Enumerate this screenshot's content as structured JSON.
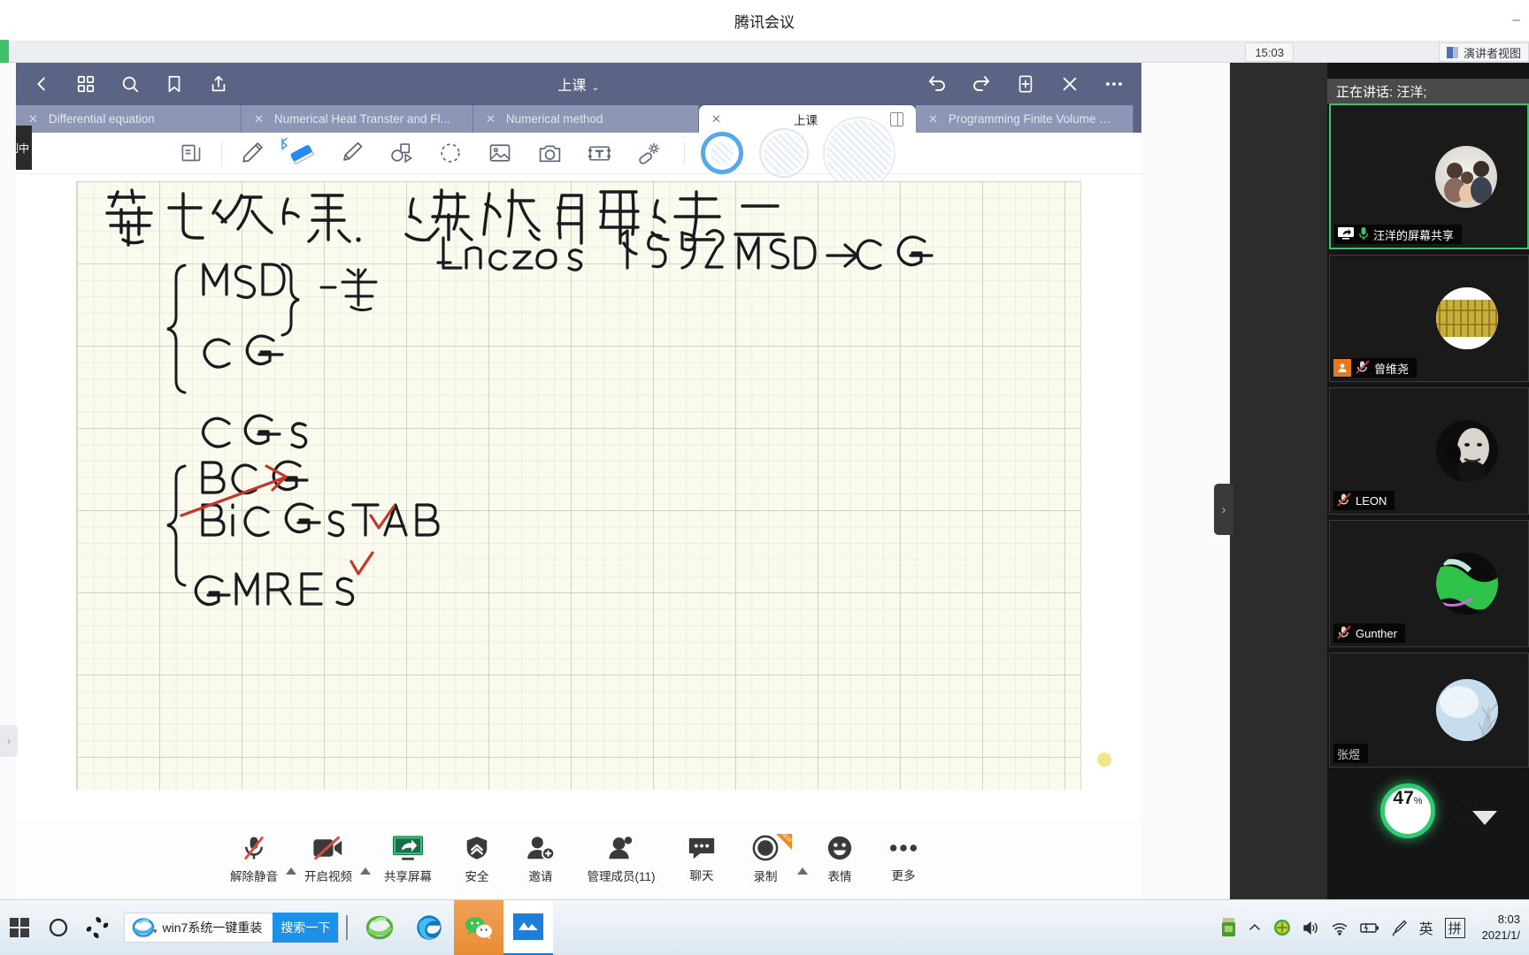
{
  "meeting": {
    "title": "腾讯会议",
    "minimize_label": "–",
    "clock": "15:03",
    "speaker_view_label": "演讲者视图",
    "recording_tag": "制中"
  },
  "note_app": {
    "doc_title": "上课",
    "doc_title_caret": "⌄",
    "top_icons_left": [
      "back-icon",
      "grid-icon",
      "search-icon",
      "bookmark-icon",
      "share-icon"
    ],
    "top_icons_right": [
      "undo-icon",
      "redo-icon",
      "add-page-icon",
      "close-icon",
      "more-icon"
    ],
    "tabs": [
      {
        "label": "Differential equation",
        "close": "✕",
        "active": false
      },
      {
        "label": "Numerical Heat Transter and Fl...",
        "close": "✕",
        "active": false
      },
      {
        "label": "Numerical method",
        "close": "✕",
        "active": false
      },
      {
        "label": "上课",
        "close": "✕",
        "active": true
      },
      {
        "label": "Programming Finite Volume Met...",
        "close": "✕",
        "active": false
      }
    ],
    "tools": [
      {
        "name": "page-layout-icon",
        "selected": false
      },
      {
        "name": "pen-icon",
        "selected": false
      },
      {
        "name": "eraser-icon",
        "selected": true
      },
      {
        "name": "highlighter-icon",
        "selected": false
      },
      {
        "name": "shapes-icon",
        "selected": false
      },
      {
        "name": "lasso-select-icon",
        "selected": false
      },
      {
        "name": "image-icon",
        "selected": false
      },
      {
        "name": "camera-icon",
        "selected": false
      },
      {
        "name": "text-box-icon",
        "selected": false
      },
      {
        "name": "magic-wand-icon",
        "selected": false
      }
    ],
    "brush_sizes": [
      {
        "name": "brush-size-small",
        "selected": true
      },
      {
        "name": "brush-size-medium",
        "selected": false
      },
      {
        "name": "brush-size-large",
        "selected": false
      }
    ]
  },
  "handwriting": {
    "title": "第七次课. 迭代解法二",
    "group1": [
      "MSD",
      "CG",
      "CGS"
    ],
    "group1_brace_note": "一类",
    "group2": [
      "BCG",
      "BiCGSTAB",
      "GMRES"
    ],
    "note_line": "Lanczos   1952   MSD → CG",
    "checks": [
      "✓",
      "✓"
    ],
    "bcg_struck_out": true
  },
  "video_sidebar": {
    "speaking_now": "正在讲话: 汪洋;",
    "participants": [
      {
        "name": "汪洋的屏幕共享",
        "muted": false,
        "host": false,
        "speaking": true,
        "avatar": "family-photo-avatar",
        "has_share_icon": true
      },
      {
        "name": "曾维尧",
        "muted": true,
        "host": true,
        "speaking": false,
        "avatar": "gold-texture-avatar",
        "has_share_icon": false
      },
      {
        "name": "LEON",
        "muted": true,
        "host": false,
        "speaking": false,
        "avatar": "portrait-avatar",
        "has_share_icon": false
      },
      {
        "name": "Gunther",
        "muted": true,
        "host": false,
        "speaking": false,
        "avatar": "green-lizard-avatar",
        "has_share_icon": false
      },
      {
        "name": "张煜",
        "muted": false,
        "host": false,
        "speaking": false,
        "avatar": "sky-tree-avatar",
        "has_share_icon": false
      }
    ],
    "collapse_arrow": "›",
    "scroll_down": "▼"
  },
  "network_widget": {
    "percent": "47",
    "percent_symbol": "%",
    "upload": "1.4K/s",
    "download": "49K/s",
    "upload_arrow": "↑",
    "download_arrow": "↓"
  },
  "bottom_toolbar": {
    "items": [
      {
        "label": "解除静音",
        "icon": "mic-muted-icon",
        "caret": true
      },
      {
        "label": "开启视频",
        "icon": "camera-off-icon",
        "caret": true
      },
      {
        "label": "共享屏幕",
        "icon": "share-screen-icon",
        "caret": false
      },
      {
        "label": "安全",
        "icon": "shield-icon",
        "caret": false
      },
      {
        "label": "邀请",
        "icon": "invite-icon",
        "caret": false
      },
      {
        "label": "管理成员(11)",
        "icon": "manage-members-icon",
        "caret": false
      },
      {
        "label": "聊天",
        "icon": "chat-icon",
        "caret": false
      },
      {
        "label": "录制",
        "icon": "record-icon",
        "caret": true,
        "badge": "NEW"
      },
      {
        "label": "表情",
        "icon": "emoji-icon",
        "caret": false
      },
      {
        "label": "更多",
        "icon": "more-dots-icon",
        "caret": false
      }
    ]
  },
  "taskbar": {
    "start_icon": "windows-start-icon",
    "cortana_icon": "cortana-circle-icon",
    "taskview_icon": "task-view-icon",
    "ie_search_value": "win7系统一键重装",
    "ie_search_button": "搜索一下",
    "apps": [
      {
        "name": "internet-explorer-icon"
      },
      {
        "name": "microsoft-edge-icon"
      },
      {
        "name": "wechat-icon"
      },
      {
        "name": "tencent-meeting-icon"
      }
    ],
    "tray": [
      {
        "name": "usb-drive-icon"
      },
      {
        "name": "show-hidden-icons-chevron"
      },
      {
        "name": "antivirus-icon"
      },
      {
        "name": "volume-icon"
      },
      {
        "name": "wifi-icon"
      },
      {
        "name": "battery-icon"
      },
      {
        "name": "pen-tray-icon"
      },
      {
        "name": "ime-english-icon",
        "label": "英"
      },
      {
        "name": "ime-pinyin-icon",
        "label": "拼"
      }
    ],
    "clock_time": "8:03",
    "clock_date": "2021/1/"
  }
}
